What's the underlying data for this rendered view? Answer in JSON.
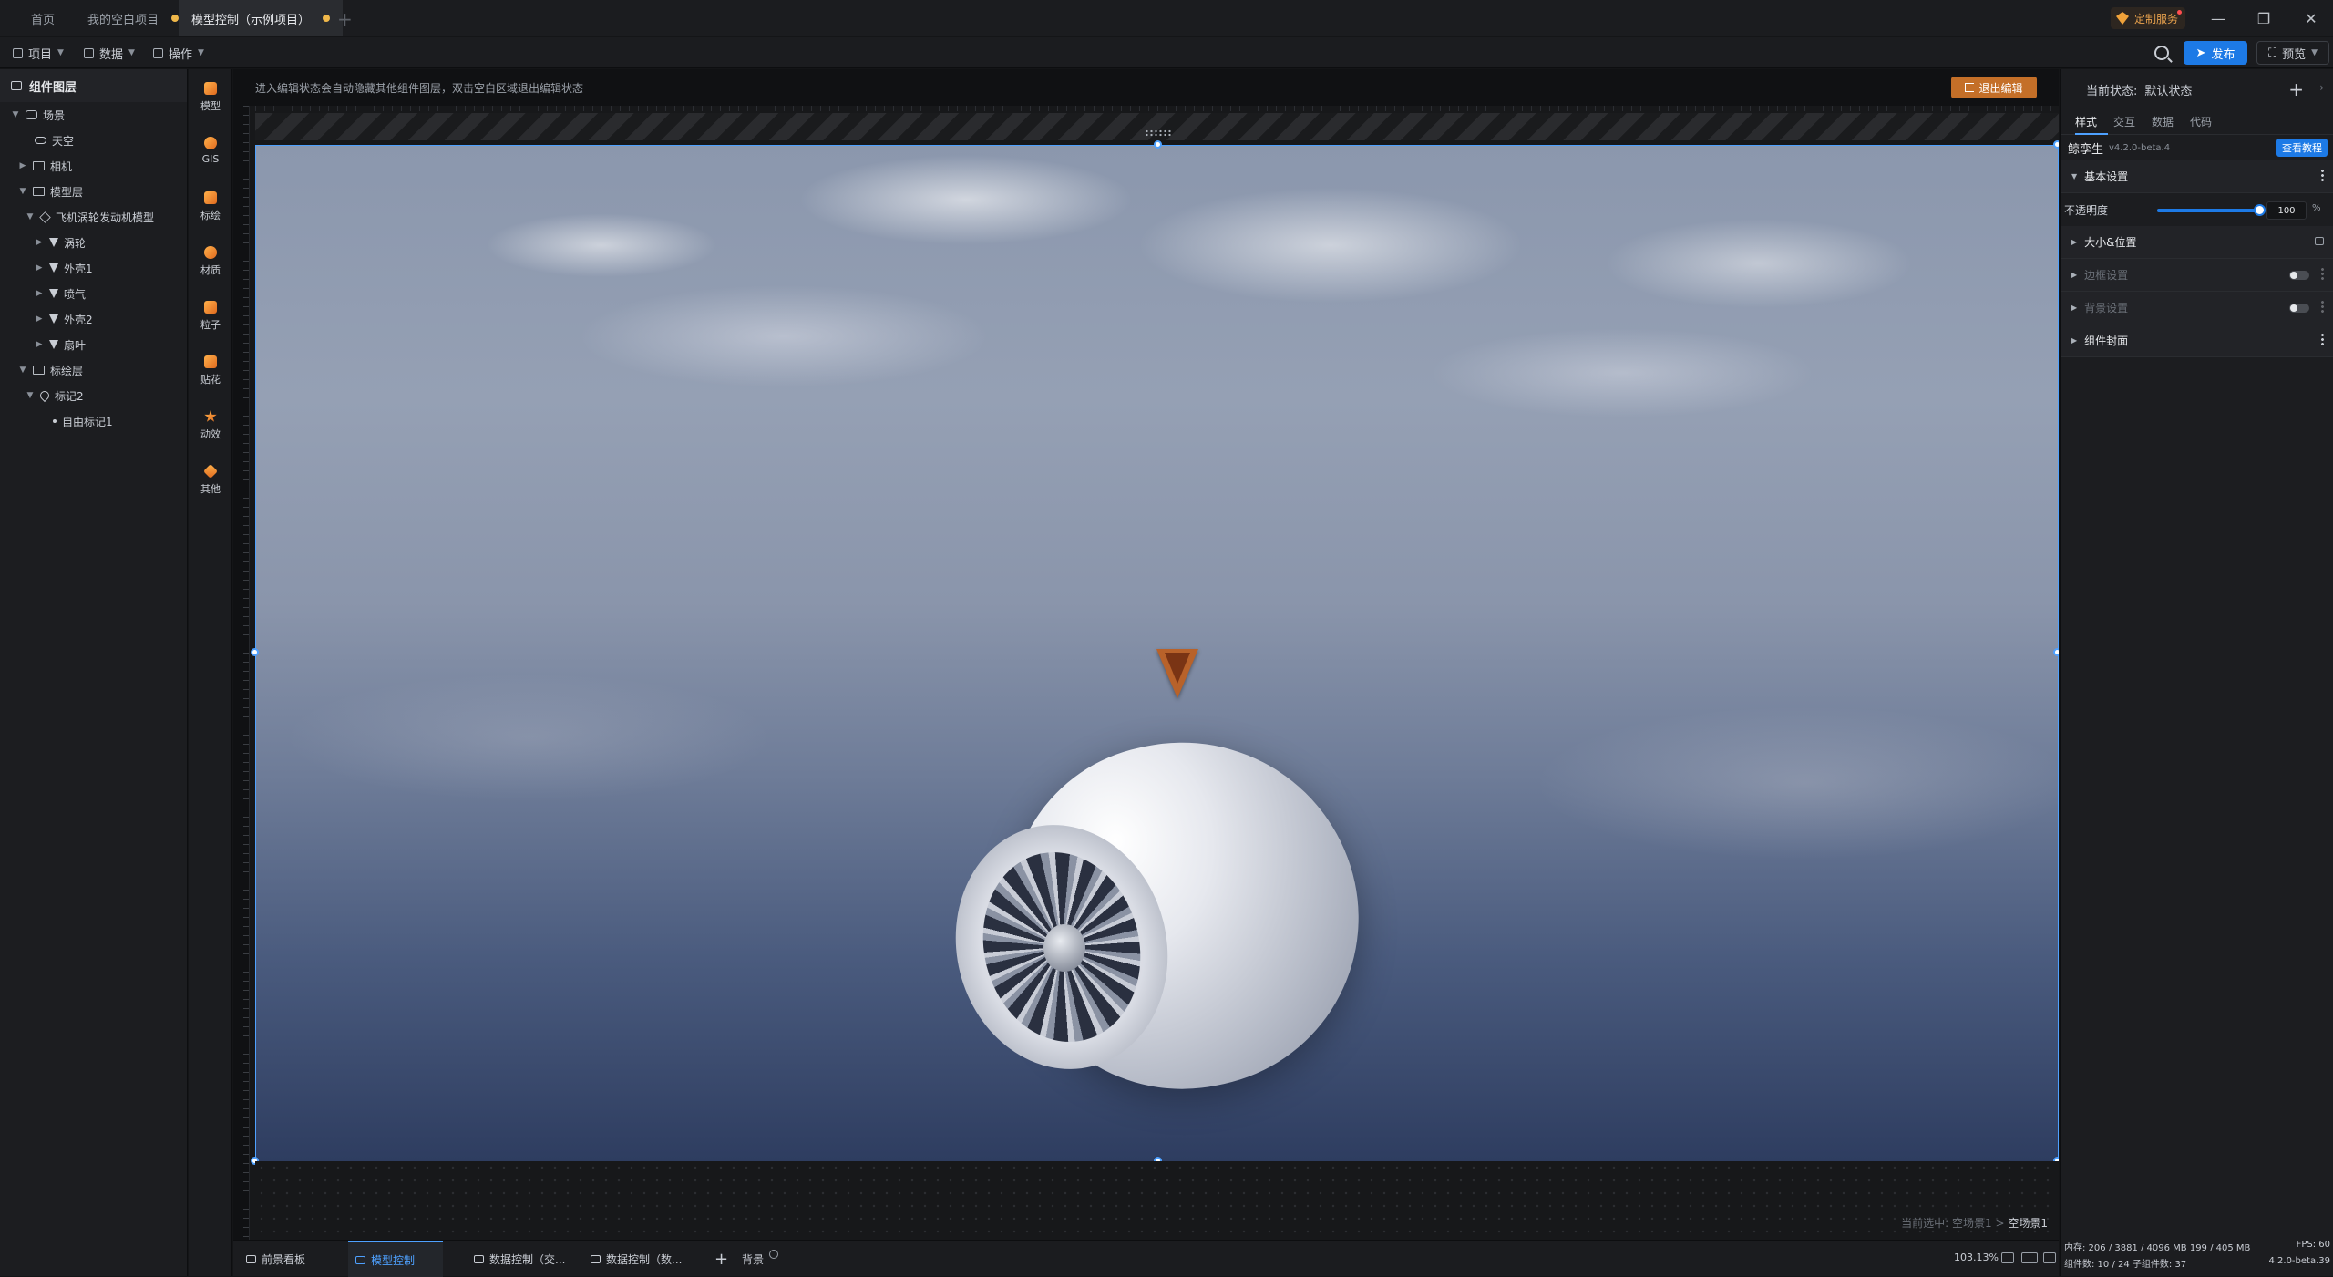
{
  "tabs": [
    {
      "label": "首页",
      "modified": false,
      "active": false
    },
    {
      "label": "我的空白项目",
      "modified": true,
      "active": false
    },
    {
      "label": "模型控制（示例项目）",
      "modified": true,
      "active": true
    }
  ],
  "titlebar": {
    "custom_service": "定制服务"
  },
  "toolbar": {
    "project": "项目",
    "data": "数据",
    "operate": "操作",
    "publish": "发布",
    "preview": "预览"
  },
  "layers": {
    "title": "组件图层",
    "items": [
      {
        "label": "场景",
        "level": 0,
        "expanded": true,
        "icon": "scene-icon"
      },
      {
        "label": "天空",
        "level": 1,
        "icon": "cloud-icon"
      },
      {
        "label": "相机",
        "level": 1,
        "expanded": false,
        "icon": "folder-icon"
      },
      {
        "label": "模型层",
        "level": 1,
        "expanded": true,
        "icon": "folder-icon"
      },
      {
        "label": "飞机涡轮发动机模型",
        "level": 2,
        "expanded": true,
        "icon": "cube-icon"
      },
      {
        "label": "涡轮",
        "level": 3,
        "icon": "mesh-icon"
      },
      {
        "label": "外壳1",
        "level": 3,
        "icon": "mesh-icon"
      },
      {
        "label": "喷气",
        "level": 3,
        "icon": "mesh-icon"
      },
      {
        "label": "外壳2",
        "level": 3,
        "icon": "mesh-icon"
      },
      {
        "label": "扇叶",
        "level": 3,
        "icon": "mesh-icon"
      },
      {
        "label": "标绘层",
        "level": 1,
        "expanded": true,
        "icon": "folder-icon"
      },
      {
        "label": "标记2",
        "level": 2,
        "expanded": true,
        "icon": "pin-icon"
      },
      {
        "label": "自由标记1",
        "level": 3,
        "icon": "bullet-icon"
      }
    ]
  },
  "components": [
    "模型",
    "GIS",
    "标绘",
    "材质",
    "粒子",
    "贴花",
    "动效",
    "其他"
  ],
  "canvas": {
    "hint": "进入编辑状态会自动隐藏其他组件图层，双击空白区域退出编辑状态",
    "exit_edit": "退出编辑",
    "crumb_prefix": "当前选中: 空场景1 >",
    "crumb_current": "空场景1"
  },
  "bottom": {
    "tabs": [
      "前景看板",
      "模型控制",
      "数据控制（交...",
      "数据控制（数...",
      "背景"
    ],
    "active_tab": 1,
    "zoom": "103.13%"
  },
  "props": {
    "state_label": "当前状态:",
    "state_value": "默认状态",
    "tabs": [
      "样式",
      "交互",
      "数据",
      "代码"
    ],
    "active_tab": 0,
    "product": "鲸孪生",
    "version": "v4.2.0-beta.4",
    "guide": "查看教程",
    "sections": {
      "basic": "基本设置",
      "opacity_label": "不透明度",
      "opacity_value": "100",
      "opacity_unit": "%",
      "size_pos": "大小&位置",
      "border": "边框设置",
      "background": "背景设置",
      "cover": "组件封面"
    },
    "status": {
      "memory": "内存:  206 / 3881 / 4096 MB  199 / 405 MB",
      "fps": "FPS:  60",
      "counts": "组件数: 10 / 24    子组件数: 37",
      "build": "4.2.0-beta.39"
    }
  },
  "opacity_fraction": 1.0,
  "colors": {
    "accent": "#1d7ae6",
    "warn": "#c46f28",
    "modified_dot": "#f0b84a"
  }
}
